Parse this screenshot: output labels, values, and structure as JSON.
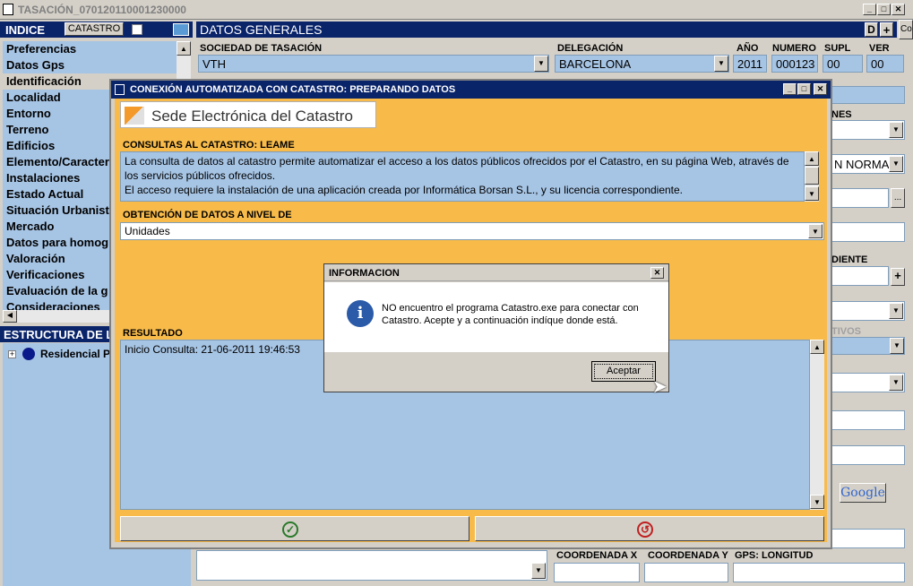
{
  "window": {
    "title": "TASACIÓN_070120110001230000",
    "min": "_",
    "max": "□",
    "close": "✕",
    "right_clip": "Co"
  },
  "indice": {
    "title": "INDICE",
    "catastro_btn": "CATASTRO",
    "items": [
      "Preferencias",
      "Datos Gps",
      "Identificación",
      "Localidad",
      "Entorno",
      "Terreno",
      "Edificios",
      "Elemento/Caracter",
      "Instalaciones",
      "Estado Actual",
      "Situación Urbanist",
      "Mercado",
      "Datos para homog",
      "Valoración",
      "Verificaciones",
      "Evaluación de la g",
      "Consideraciones"
    ]
  },
  "estructura": {
    "title": "ESTRUCTURA DE L",
    "tree_item": "Residencial P"
  },
  "datos": {
    "title": "DATOS GENERALES",
    "btn_d": "D",
    "btn_plus": "+",
    "labels": {
      "sociedad": "SOCIEDAD DE TASACIÓN",
      "delegacion": "DELEGACIÓN",
      "anio": "AÑO",
      "numero": "NUMERO",
      "supl": "SUPL",
      "ver": "VER"
    },
    "values": {
      "sociedad": "VTH",
      "delegacion": "BARCELONA",
      "anio": "2011",
      "numero": "000123",
      "supl": "00",
      "ver": "00"
    },
    "right_labels": {
      "r1": "NES",
      "r2": "N NORMA",
      "r3": "DIENTE",
      "r4": "TIVOS"
    },
    "coords": {
      "x": "COORDENADA X",
      "y": "COORDENADA Y",
      "gps": "GPS: LONGITUD"
    },
    "google": "Google"
  },
  "dialog": {
    "title": "CONEXIÓN AUTOMATIZADA CON CATASTRO: PREPARANDO DATOS",
    "brand": "Sede Electrónica del Catastro",
    "consultas_label": "CONSULTAS AL CATASTRO: LEAME",
    "consultas_text": "La consulta de datos al catastro permite automatizar el acceso a los datos públicos ofrecidos por el Catastro, en su página Web, através de los servicios públicos ofrecidos.\nEl acceso requiere la instalación de una aplicación creada por Informática Borsan S.L., y su licencia correspondiente.",
    "obtencion_label": "OBTENCIÓN DE DATOS A NIVEL DE",
    "obtencion_value": "Unidades",
    "resultado_label": "RESULTADO",
    "resultado_text": "Inicio Consulta: 21-06-2011 19:46:53"
  },
  "info": {
    "title": "INFORMACION",
    "message": "NO encuentro el programa Catastro.exe para conectar con Catastro. Acepte y a continuación indíque donde está.",
    "button": "Aceptar"
  },
  "colors": {
    "navy": "#0a246a",
    "orange": "#f8bb4a",
    "field": "#a6c4e4"
  }
}
